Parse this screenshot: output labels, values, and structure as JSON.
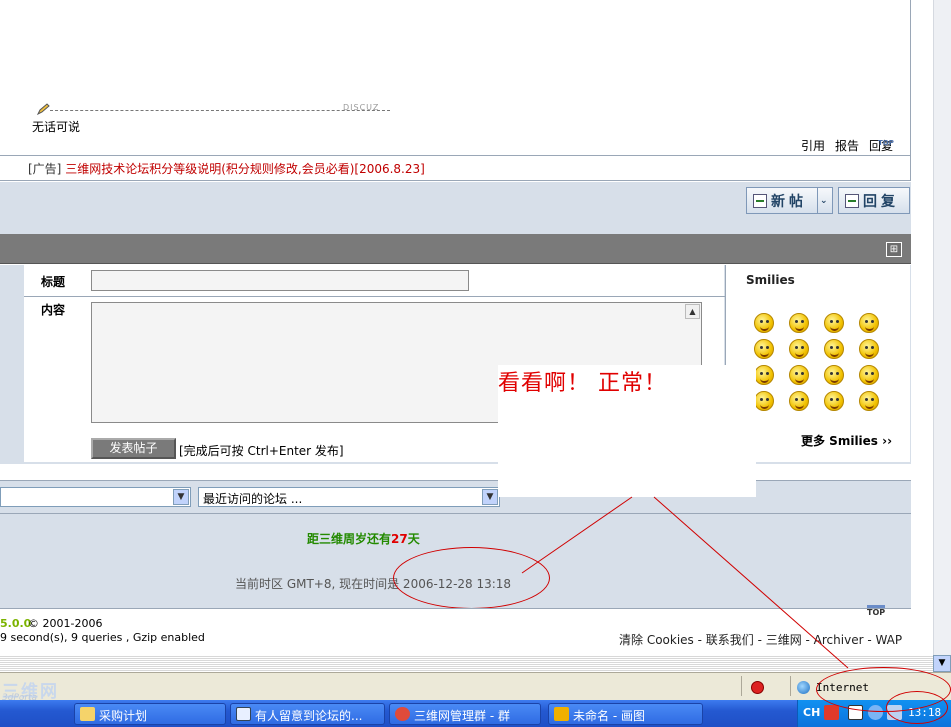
{
  "post": {
    "signature_tag": "DISCUZ",
    "signature_text": "无话可说",
    "actions": [
      "引用",
      "报告",
      "回复"
    ],
    "top_small": "TOP"
  },
  "ad": {
    "tag": "[广告]",
    "link": "三维网技术论坛积分等级说明(积分规则修改,会员必看)[2006.8.23]"
  },
  "toolbar": {
    "new_thread_label": "新帖",
    "reply_label": "回复",
    "dropdown_arrow": "⌄"
  },
  "quick_reply": {
    "collapse_icon": "⊞",
    "title_label": "标题",
    "content_label": "内容",
    "title_value": "",
    "content_value": "",
    "submit_label": "发表帖子",
    "submit_hint": "[完成后可按 Ctrl+Enter 发布]",
    "scroll_up": "▲"
  },
  "smilies": {
    "title": "Smilies",
    "more": "更多 Smilies ››",
    "icons": [
      "smile-icon",
      "wink-icon",
      "frog-icon",
      "victory-icon",
      "clock-icon",
      "lips-icon",
      "handshake-icon",
      "phone-icon",
      "blush-icon",
      "angry-icon",
      "tongue-icon",
      "sad-icon",
      "laugh-icon",
      "cry-icon",
      "bandage-icon",
      "shout-icon"
    ]
  },
  "overlay": {
    "text": "看看啊！ 正常！"
  },
  "jump": {
    "forum_value": "",
    "recent_value": "最近访问的论坛 ...",
    "arrow": "▼"
  },
  "footer": {
    "countdown_prefix": "距三维周岁还有",
    "countdown_days": "27",
    "countdown_suffix": "天",
    "timezone": "当前时区 GMT+8, 现在时间是 2006-12-28 13:18",
    "version": "5.0.0",
    "copyright": "© 2001-2006",
    "stats": "9 second(s), 9 queries , Gzip enabled",
    "links": "清除 Cookies - 联系我们 - 三维网 - Archiver - WAP",
    "top": "TOP"
  },
  "scroll": {
    "down": "▼"
  },
  "status_bar": {
    "logo": "三维网",
    "logo_sub": "3dPorta",
    "zone": "Internet"
  },
  "taskbar": {
    "tasks": [
      "采购计划",
      "有人留意到论坛的...",
      "三维网管理群 - 群",
      "未命名 - 画图"
    ],
    "lang": "CH",
    "clock": "13:18"
  },
  "colors": {
    "panel_bg": "#d7dfe9",
    "header_gray": "#7a7a7a",
    "ad_red": "#c00000",
    "annotation_red": "#d00000",
    "taskbar_blue": "#2459d1"
  }
}
